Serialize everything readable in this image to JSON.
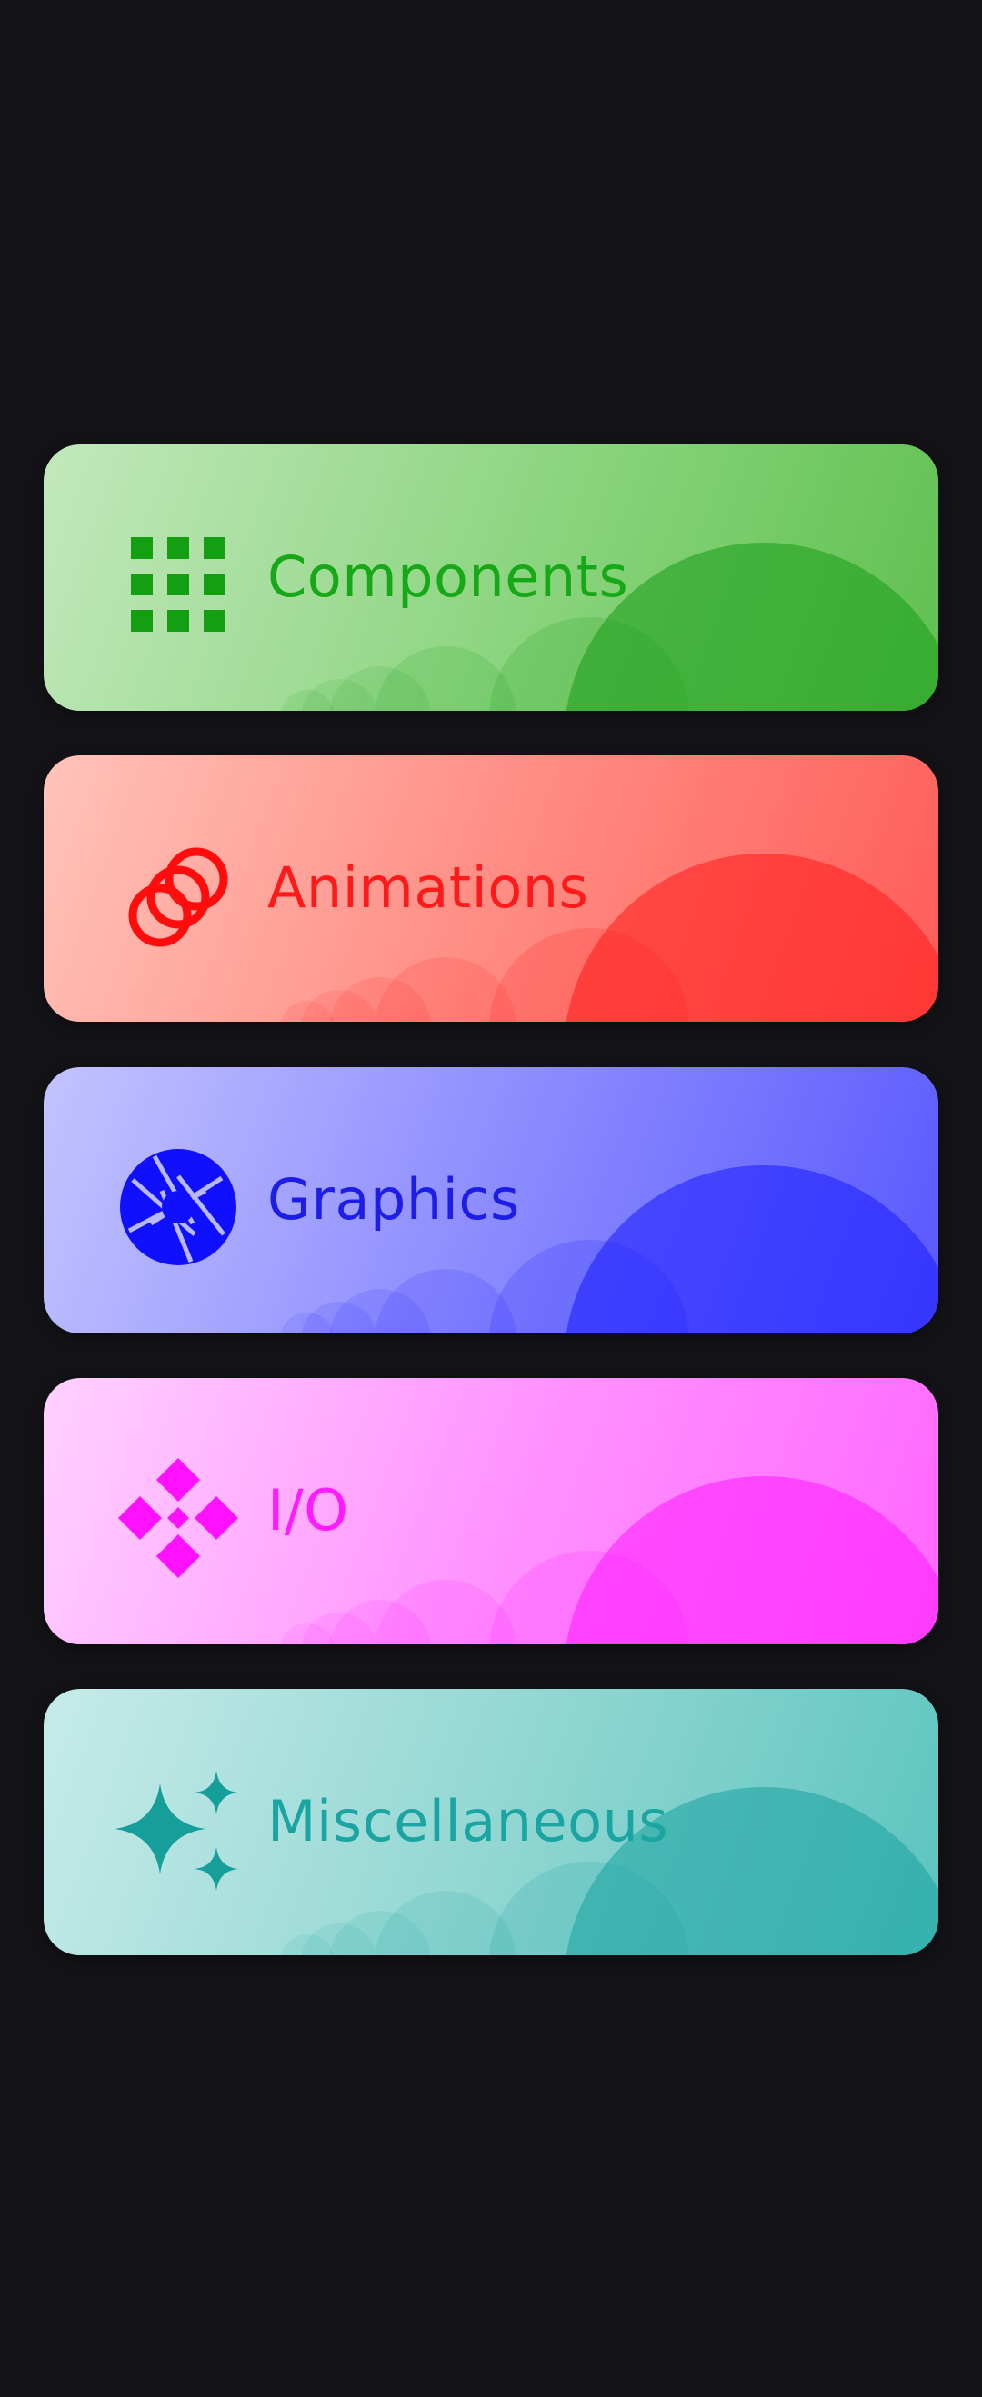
{
  "menu": {
    "items": [
      {
        "label": "Components",
        "icon": "grid-icon",
        "accent": "#17a817",
        "text_color": "#17a817"
      },
      {
        "label": "Animations",
        "icon": "rings-icon",
        "accent": "#ff1010",
        "text_color": "#ff1a1a"
      },
      {
        "label": "Graphics",
        "icon": "aperture-icon",
        "accent": "#1414ff",
        "text_color": "#1d1de8"
      },
      {
        "label": "I/O",
        "icon": "diamond-pattern-icon",
        "accent": "#ff11ff",
        "text_color": "#ff1aff"
      },
      {
        "label": "Miscellaneous",
        "icon": "sparkles-icon",
        "accent": "#16a3a0",
        "text_color": "#1aa5a2"
      }
    ]
  }
}
